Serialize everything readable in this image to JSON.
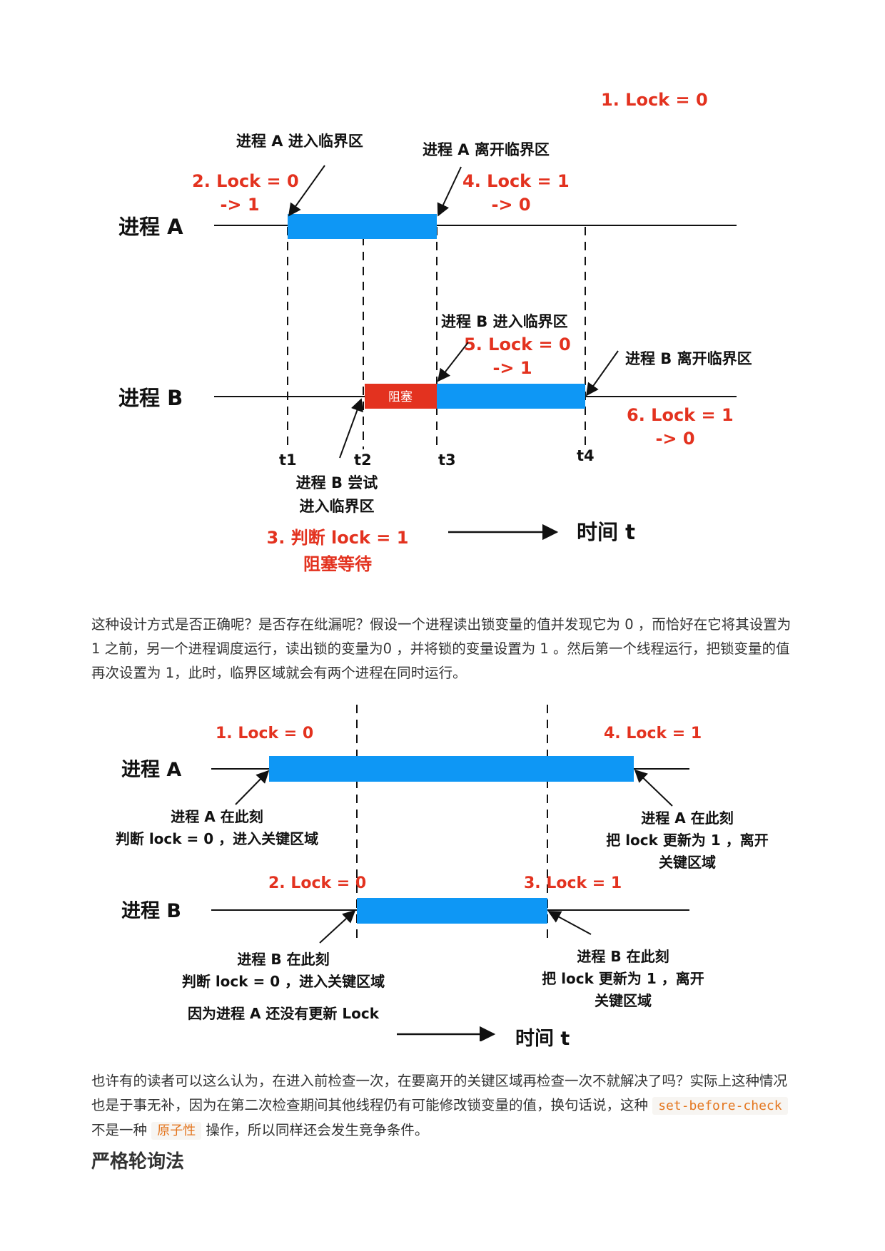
{
  "diagram1": {
    "lock_init": "1. Lock = 0",
    "proc_a": "进程 A",
    "proc_b": "进程 B",
    "a_enter_label": "进程 A  进入临界区",
    "a_leave_label": "进程 A  离开临界区",
    "lock2_l1": "2. Lock = 0",
    "lock2_l2": "-> 1",
    "lock4_l1": "4. Lock = 1",
    "lock4_l2": "-> 0",
    "b_enter_label": "进程 B  进入临界区",
    "lock5_l1": "5. Lock = 0",
    "lock5_l2": "-> 1",
    "b_leave_label": "进程 B  离开临界区",
    "blocked": "阻塞",
    "lock6_l1": "6. Lock = 1",
    "lock6_l2": "-> 0",
    "t1": "t1",
    "t2": "t2",
    "t3": "t3",
    "t4": "t4",
    "b_try_l1": "进程 B 尝试",
    "b_try_l2": "进入临界区",
    "step3_l1": "3. 判断 lock = 1",
    "step3_l2": "阻塞等待",
    "time": "时间 t"
  },
  "para1": "这种设计方式是否正确呢？是否存在纰漏呢？假设一个进程读出锁变量的值并发现它为 0 ，而恰好在它将其设置为 1 之前，另一个进程调度运行，读出锁的变量为0 ，并将锁的变量设置为 1 。然后第一个线程运行，把锁变量的值再次设置为 1，此时，临界区域就会有两个进程在同时运行。",
  "diagram2": {
    "lock1": "1. Lock = 0",
    "lock4": "4. Lock = 1",
    "proc_a": "进程 A",
    "proc_b": "进程 B",
    "a_here_l1": "进程 A 在此刻",
    "a_here_l2": "判断 lock = 0 ，进入关键区域",
    "a_update_l1": "进程 A 在此刻",
    "a_update_l2": "把 lock 更新为 1 ，离开",
    "a_update_l3": "关键区域",
    "lock2": "2. Lock = 0",
    "lock3": "3. Lock = 1",
    "b_here_l1": "进程 B 在此刻",
    "b_here_l2": "判断 lock = 0 ，进入关键区域",
    "b_reason": "因为进程 A 还没有更新 Lock",
    "b_update_l1": "进程 B 在此刻",
    "b_update_l2": "把 lock 更新为 1 ，离开",
    "b_update_l3": "关键区域",
    "time": "时间 t"
  },
  "para2": {
    "text1": "也许有的读者可以这么认为，在进入前检查一次，在要离开的关键区域再检查一次不就解决了吗？实际上这种情况也是于事无补，因为在第二次检查期间其他线程仍有可能修改锁变量的值，换句话说，这种 ",
    "code1": "set-before-check",
    "text2": " 不是一种 ",
    "code2": "原子性",
    "text3": " 操作，所以同样还会发生竞争条件。"
  },
  "heading": "严格轮询法",
  "colors": {
    "bar": "#0e97f5",
    "blocked": "#e3321f",
    "accent_red": "#e3321f"
  }
}
